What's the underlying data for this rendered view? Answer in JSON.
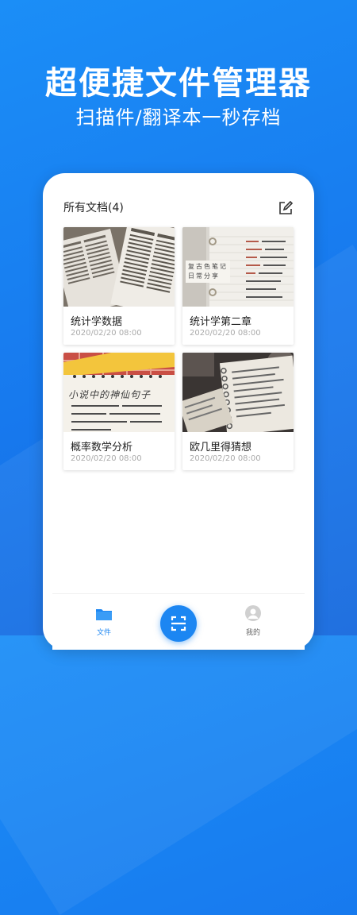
{
  "hero": {
    "headline": "超便捷文件管理器",
    "subline": "扫描件/翻译本一秒存档"
  },
  "header": {
    "title": "所有文档(4)",
    "edit_icon": "edit-icon"
  },
  "documents": [
    {
      "name": "统计学数据",
      "date": "2020/02/20 08:00"
    },
    {
      "name": "统计学第二章",
      "date": "2020/02/20 08:00"
    },
    {
      "name": "概率数学分析",
      "date": "2020/02/20 08:00"
    },
    {
      "name": "欧几里得猜想",
      "date": "2020/02/20 08:00"
    }
  ],
  "thumb_text": {
    "notebook_stamp": [
      "复古色笔记",
      "日常分享"
    ],
    "handwriting_title": "小说中的神仙句子"
  },
  "tabbar": {
    "files_label": "文件",
    "mine_label": "我的",
    "scan_icon": "scan-icon"
  },
  "colors": {
    "primary": "#1c86f2",
    "background": "#1779ee"
  }
}
